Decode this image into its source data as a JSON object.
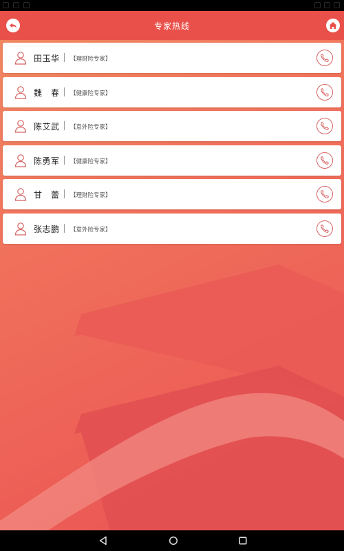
{
  "header": {
    "title": "专家热线"
  },
  "experts": [
    {
      "name": "田玉华",
      "tag": "【理财险专家】"
    },
    {
      "name": "魏　春",
      "tag": "【健康险专家】"
    },
    {
      "name": "陈艾武",
      "tag": "【意外险专家】"
    },
    {
      "name": "陈勇军",
      "tag": "【健康险专家】"
    },
    {
      "name": "甘　蕾",
      "tag": "【理财险专家】"
    },
    {
      "name": "张志鹏",
      "tag": "【意外险专家】"
    }
  ],
  "icons": {
    "back": "back-arrow-icon",
    "home": "home-icon",
    "avatar": "person-icon",
    "call": "phone-icon",
    "nav_back": "triangle-back-icon",
    "nav_home": "circle-home-icon",
    "nav_recent": "square-recent-icon"
  },
  "colors": {
    "accent": "#e9504a",
    "icon": "#d76363",
    "background": "#f06a5a"
  }
}
